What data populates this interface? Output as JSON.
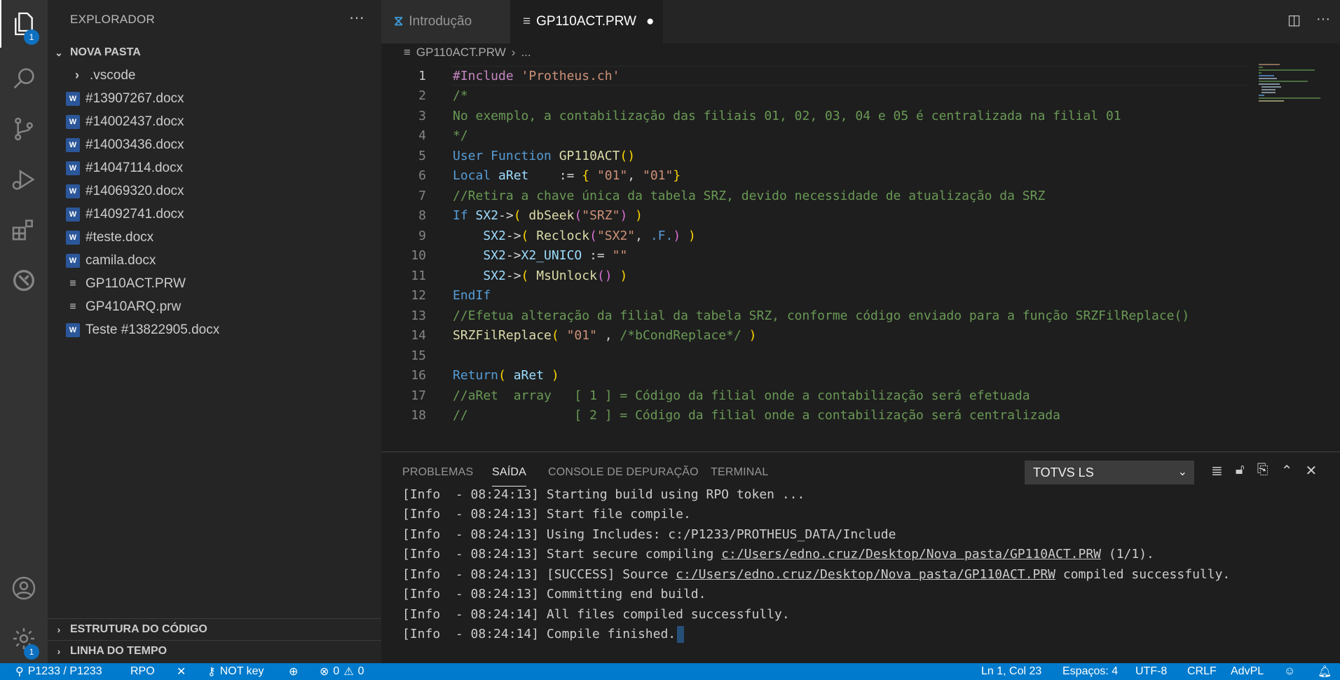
{
  "activity": {
    "explorer_badge": "1",
    "settings_badge": "1"
  },
  "sidebar": {
    "title": "EXPLORADOR",
    "more": "···",
    "folder": "NOVA PASTA",
    "items": [
      {
        "label": ".vscode",
        "icon": "chevron-right-icon"
      },
      {
        "label": "#13907267.docx",
        "icon": "word-file-icon"
      },
      {
        "label": "#14002437.docx",
        "icon": "word-file-icon"
      },
      {
        "label": "#14003436.docx",
        "icon": "word-file-icon"
      },
      {
        "label": "#14047114.docx",
        "icon": "word-file-icon"
      },
      {
        "label": "#14069320.docx",
        "icon": "word-file-icon"
      },
      {
        "label": "#14092741.docx",
        "icon": "word-file-icon"
      },
      {
        "label": "#teste.docx",
        "icon": "word-file-icon"
      },
      {
        "label": "camila.docx",
        "icon": "word-file-icon"
      },
      {
        "label": "GP110ACT.PRW",
        "icon": "text-file-icon"
      },
      {
        "label": "GP410ARQ.prw",
        "icon": "text-file-icon"
      },
      {
        "label": "Teste #13822905.docx",
        "icon": "word-file-icon"
      }
    ],
    "outline": "ESTRUTURA DO CÓDIGO",
    "timeline": "LINHA DO TEMPO"
  },
  "tabs": [
    {
      "label": "Introdução"
    },
    {
      "label": "GP110ACT.PRW"
    }
  ],
  "breadcrumb": {
    "file": "GP110ACT.PRW",
    "rest": "..."
  },
  "editor": {
    "line_numbers": [
      "1",
      "2",
      "3",
      "4",
      "5",
      "6",
      "7",
      "8",
      "9",
      "10",
      "11",
      "12",
      "13",
      "14",
      "15",
      "16",
      "17",
      "18"
    ],
    "lines": {
      "l1a": "#Include ",
      "l1b": "'Protheus.ch'",
      "l2": "/*",
      "l3": "No exemplo, a contabilização das filiais 01, 02, 03, 04 e 05 é centralizada na filial 01",
      "l4": "*/",
      "l5a": "User Function ",
      "l5b": "GP110ACT",
      "l5c": "()",
      "l6a": "Local ",
      "l6b": "aRet",
      "l6c": "    := ",
      "l6d": "{",
      "l6e": " ",
      "l6f": "\"01\"",
      "l6g": ", ",
      "l6h": "\"01\"",
      "l6i": "}",
      "l7": "//Retira a chave única da tabela SRZ, devido necessidade de atualização da SRZ",
      "l8a": "If ",
      "l8b": "SX2",
      "l8c": "->",
      "l8d": "( ",
      "l8e": "dbSeek",
      "l8f": "(",
      "l8g": "\"SRZ\"",
      "l8h": ")",
      "l8i": " )",
      "l9a": "    SX2",
      "l9b": "->",
      "l9c": "( ",
      "l9d": "Reclock",
      "l9e": "(",
      "l9f": "\"SX2\"",
      "l9g": ", ",
      "l9h": ".F.",
      "l9i": ")",
      "l9j": " )",
      "l10a": "    SX2",
      "l10b": "->",
      "l10c": "X2_UNICO",
      "l10d": " := ",
      "l10e": "\"\"",
      "l11a": "    SX2",
      "l11b": "->",
      "l11c": "( ",
      "l11d": "MsUnlock",
      "l11e": "()",
      "l11f": " )",
      "l12": "EndIf",
      "l13": "//Efetua alteração da filial da tabela SRZ, conforme código enviado para a função SRZFilReplace()",
      "l14a": "SRZFilReplace",
      "l14b": "( ",
      "l14c": "\"01\"",
      "l14d": " , ",
      "l14e": "/*bCondReplace*/",
      "l14f": " )",
      "l16a": "Return",
      "l16b": "( ",
      "l16c": "aRet",
      "l16d": " )",
      "l17": "//aRet  array   [ 1 ] = Código da filial onde a contabilização será efetuada",
      "l18": "//              [ 2 ] = Código da filial onde a contabilização será centralizada"
    }
  },
  "panel": {
    "tabs": [
      "PROBLEMAS",
      "SAÍDA",
      "CONSOLE DE DEPURAÇÃO",
      "TERMINAL"
    ],
    "channel": "TOTVS LS",
    "output": [
      {
        "pre": "[Info  - 08:24:13] Starting build using RPO token ...",
        "link": "",
        "post": ""
      },
      {
        "pre": "[Info  - 08:24:13] Start file compile.",
        "link": "",
        "post": ""
      },
      {
        "pre": "[Info  - 08:24:13] Using Includes: c:/P1233/PROTHEUS_DATA/Include",
        "link": "",
        "post": ""
      },
      {
        "pre": "[Info  - 08:24:13] Start secure compiling ",
        "link": "c:/Users/edno.cruz/Desktop/Nova pasta/GP110ACT.PRW",
        "post": " (1/1)."
      },
      {
        "pre": "[Info  - 08:24:13] [SUCCESS] Source ",
        "link": "c:/Users/edno.cruz/Desktop/Nova pasta/GP110ACT.PRW",
        "post": " compiled successfully."
      },
      {
        "pre": "[Info  - 08:24:13] Committing end build.",
        "link": "",
        "post": ""
      },
      {
        "pre": "[Info  - 08:24:14] All files compiled successfully.",
        "link": "",
        "post": ""
      },
      {
        "pre": "[Info  - 08:24:14] Compile finished.",
        "link": "",
        "post": ""
      }
    ]
  },
  "status": {
    "server": "P1233 / P1233",
    "rpo": "RPO",
    "key": "NOT key",
    "errors": "0",
    "warnings": "0",
    "position": "Ln 1, Col 23",
    "spaces": "Espaços: 4",
    "encoding": "UTF-8",
    "eol": "CRLF",
    "language": "AdvPL"
  }
}
